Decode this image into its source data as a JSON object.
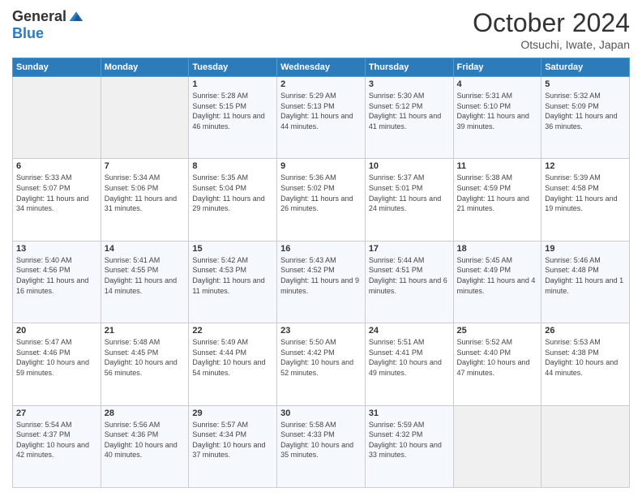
{
  "header": {
    "logo_general": "General",
    "logo_blue": "Blue",
    "title": "October 2024",
    "subtitle": "Otsuchi, Iwate, Japan"
  },
  "calendar": {
    "days_of_week": [
      "Sunday",
      "Monday",
      "Tuesday",
      "Wednesday",
      "Thursday",
      "Friday",
      "Saturday"
    ],
    "weeks": [
      [
        {
          "day": "",
          "sunrise": "",
          "sunset": "",
          "daylight": ""
        },
        {
          "day": "",
          "sunrise": "",
          "sunset": "",
          "daylight": ""
        },
        {
          "day": "1",
          "sunrise": "Sunrise: 5:28 AM",
          "sunset": "Sunset: 5:15 PM",
          "daylight": "Daylight: 11 hours and 46 minutes."
        },
        {
          "day": "2",
          "sunrise": "Sunrise: 5:29 AM",
          "sunset": "Sunset: 5:13 PM",
          "daylight": "Daylight: 11 hours and 44 minutes."
        },
        {
          "day": "3",
          "sunrise": "Sunrise: 5:30 AM",
          "sunset": "Sunset: 5:12 PM",
          "daylight": "Daylight: 11 hours and 41 minutes."
        },
        {
          "day": "4",
          "sunrise": "Sunrise: 5:31 AM",
          "sunset": "Sunset: 5:10 PM",
          "daylight": "Daylight: 11 hours and 39 minutes."
        },
        {
          "day": "5",
          "sunrise": "Sunrise: 5:32 AM",
          "sunset": "Sunset: 5:09 PM",
          "daylight": "Daylight: 11 hours and 36 minutes."
        }
      ],
      [
        {
          "day": "6",
          "sunrise": "Sunrise: 5:33 AM",
          "sunset": "Sunset: 5:07 PM",
          "daylight": "Daylight: 11 hours and 34 minutes."
        },
        {
          "day": "7",
          "sunrise": "Sunrise: 5:34 AM",
          "sunset": "Sunset: 5:06 PM",
          "daylight": "Daylight: 11 hours and 31 minutes."
        },
        {
          "day": "8",
          "sunrise": "Sunrise: 5:35 AM",
          "sunset": "Sunset: 5:04 PM",
          "daylight": "Daylight: 11 hours and 29 minutes."
        },
        {
          "day": "9",
          "sunrise": "Sunrise: 5:36 AM",
          "sunset": "Sunset: 5:02 PM",
          "daylight": "Daylight: 11 hours and 26 minutes."
        },
        {
          "day": "10",
          "sunrise": "Sunrise: 5:37 AM",
          "sunset": "Sunset: 5:01 PM",
          "daylight": "Daylight: 11 hours and 24 minutes."
        },
        {
          "day": "11",
          "sunrise": "Sunrise: 5:38 AM",
          "sunset": "Sunset: 4:59 PM",
          "daylight": "Daylight: 11 hours and 21 minutes."
        },
        {
          "day": "12",
          "sunrise": "Sunrise: 5:39 AM",
          "sunset": "Sunset: 4:58 PM",
          "daylight": "Daylight: 11 hours and 19 minutes."
        }
      ],
      [
        {
          "day": "13",
          "sunrise": "Sunrise: 5:40 AM",
          "sunset": "Sunset: 4:56 PM",
          "daylight": "Daylight: 11 hours and 16 minutes."
        },
        {
          "day": "14",
          "sunrise": "Sunrise: 5:41 AM",
          "sunset": "Sunset: 4:55 PM",
          "daylight": "Daylight: 11 hours and 14 minutes."
        },
        {
          "day": "15",
          "sunrise": "Sunrise: 5:42 AM",
          "sunset": "Sunset: 4:53 PM",
          "daylight": "Daylight: 11 hours and 11 minutes."
        },
        {
          "day": "16",
          "sunrise": "Sunrise: 5:43 AM",
          "sunset": "Sunset: 4:52 PM",
          "daylight": "Daylight: 11 hours and 9 minutes."
        },
        {
          "day": "17",
          "sunrise": "Sunrise: 5:44 AM",
          "sunset": "Sunset: 4:51 PM",
          "daylight": "Daylight: 11 hours and 6 minutes."
        },
        {
          "day": "18",
          "sunrise": "Sunrise: 5:45 AM",
          "sunset": "Sunset: 4:49 PM",
          "daylight": "Daylight: 11 hours and 4 minutes."
        },
        {
          "day": "19",
          "sunrise": "Sunrise: 5:46 AM",
          "sunset": "Sunset: 4:48 PM",
          "daylight": "Daylight: 11 hours and 1 minute."
        }
      ],
      [
        {
          "day": "20",
          "sunrise": "Sunrise: 5:47 AM",
          "sunset": "Sunset: 4:46 PM",
          "daylight": "Daylight: 10 hours and 59 minutes."
        },
        {
          "day": "21",
          "sunrise": "Sunrise: 5:48 AM",
          "sunset": "Sunset: 4:45 PM",
          "daylight": "Daylight: 10 hours and 56 minutes."
        },
        {
          "day": "22",
          "sunrise": "Sunrise: 5:49 AM",
          "sunset": "Sunset: 4:44 PM",
          "daylight": "Daylight: 10 hours and 54 minutes."
        },
        {
          "day": "23",
          "sunrise": "Sunrise: 5:50 AM",
          "sunset": "Sunset: 4:42 PM",
          "daylight": "Daylight: 10 hours and 52 minutes."
        },
        {
          "day": "24",
          "sunrise": "Sunrise: 5:51 AM",
          "sunset": "Sunset: 4:41 PM",
          "daylight": "Daylight: 10 hours and 49 minutes."
        },
        {
          "day": "25",
          "sunrise": "Sunrise: 5:52 AM",
          "sunset": "Sunset: 4:40 PM",
          "daylight": "Daylight: 10 hours and 47 minutes."
        },
        {
          "day": "26",
          "sunrise": "Sunrise: 5:53 AM",
          "sunset": "Sunset: 4:38 PM",
          "daylight": "Daylight: 10 hours and 44 minutes."
        }
      ],
      [
        {
          "day": "27",
          "sunrise": "Sunrise: 5:54 AM",
          "sunset": "Sunset: 4:37 PM",
          "daylight": "Daylight: 10 hours and 42 minutes."
        },
        {
          "day": "28",
          "sunrise": "Sunrise: 5:56 AM",
          "sunset": "Sunset: 4:36 PM",
          "daylight": "Daylight: 10 hours and 40 minutes."
        },
        {
          "day": "29",
          "sunrise": "Sunrise: 5:57 AM",
          "sunset": "Sunset: 4:34 PM",
          "daylight": "Daylight: 10 hours and 37 minutes."
        },
        {
          "day": "30",
          "sunrise": "Sunrise: 5:58 AM",
          "sunset": "Sunset: 4:33 PM",
          "daylight": "Daylight: 10 hours and 35 minutes."
        },
        {
          "day": "31",
          "sunrise": "Sunrise: 5:59 AM",
          "sunset": "Sunset: 4:32 PM",
          "daylight": "Daylight: 10 hours and 33 minutes."
        },
        {
          "day": "",
          "sunrise": "",
          "sunset": "",
          "daylight": ""
        },
        {
          "day": "",
          "sunrise": "",
          "sunset": "",
          "daylight": ""
        }
      ]
    ]
  }
}
